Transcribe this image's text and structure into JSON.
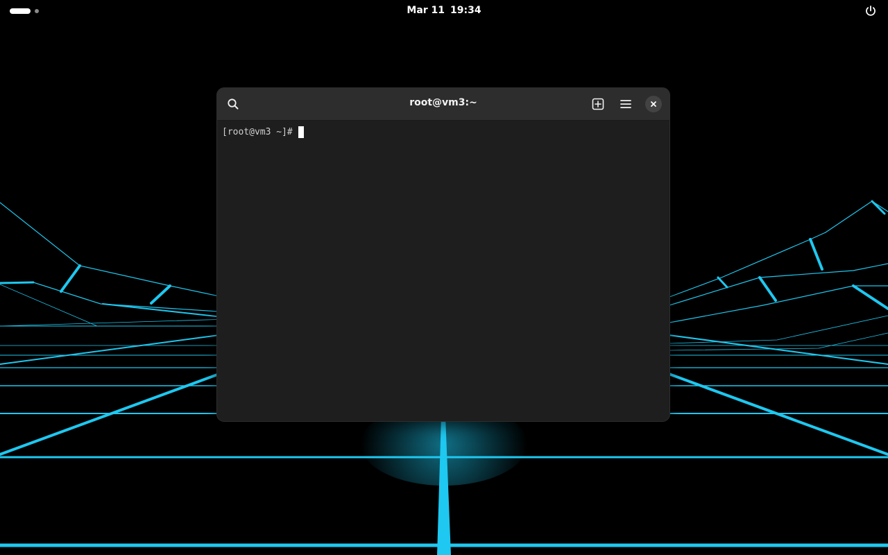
{
  "topbar": {
    "date": "Mar 11",
    "time": "19:34",
    "activities_icon": "workspace-indicator",
    "power_icon": "power-icon"
  },
  "terminal": {
    "title": "root@vm3:~",
    "prompt": "[root@vm3 ~]#",
    "icons": {
      "search": "search-icon",
      "new_tab": "new-tab-icon",
      "menu": "hamburger-menu-icon",
      "close": "close-icon"
    },
    "colors": {
      "body": "#1e1e1e",
      "header": "#2d2d2d",
      "text": "#d0d0d0"
    }
  },
  "wallpaper": {
    "accent": "#1ec8f0"
  }
}
